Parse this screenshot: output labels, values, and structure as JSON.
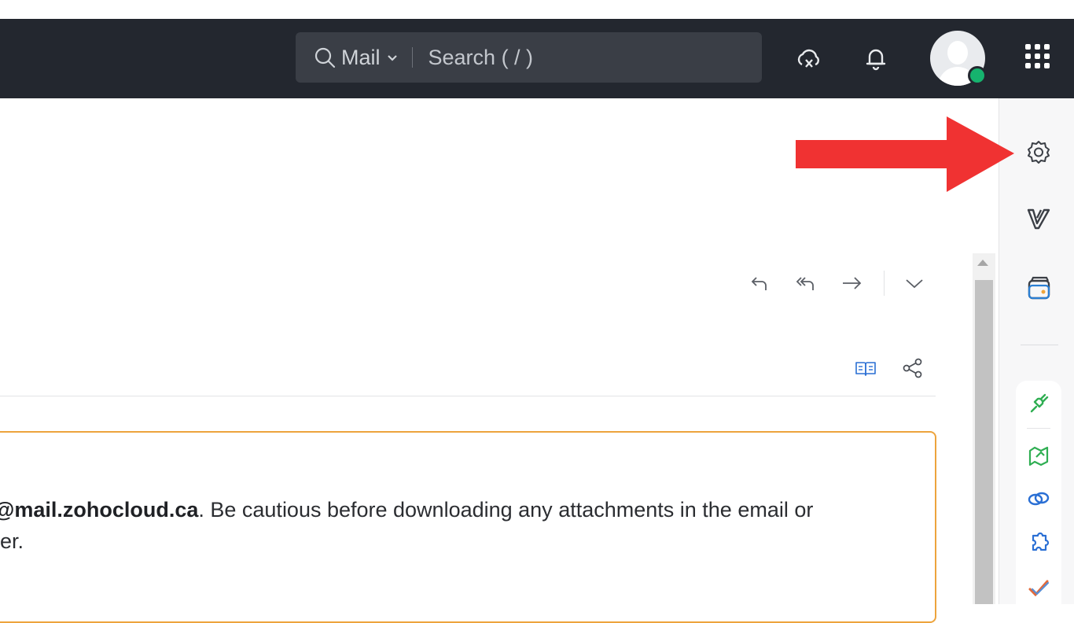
{
  "search": {
    "scope_label": "Mail",
    "placeholder": "Search ( / )"
  },
  "topbar_icons": [
    "cloud-sync-icon",
    "bell-icon",
    "avatar",
    "apps-grid-icon"
  ],
  "right_rail": {
    "icons": [
      "gear-icon",
      "v-logo-icon",
      "wallet-icon",
      "plug-icon",
      "map-icon",
      "link-icon",
      "puzzle-icon",
      "check-icon"
    ]
  },
  "mail_actions": [
    "reply-icon",
    "reply-all-icon",
    "forward-icon",
    "chevron-down-icon",
    "reader-view-icon",
    "share-icon"
  ],
  "warning": {
    "domain": "@mail.zohocloud.ca",
    "text": ". Be cautious before downloading any attachments in the email or",
    "line2": "er."
  },
  "colors": {
    "topbar": "#23272f",
    "search_bg": "#3a3e46",
    "warning_border": "#eda43d",
    "presence": "#16b36e",
    "annotation_arrow": "#f03232"
  }
}
